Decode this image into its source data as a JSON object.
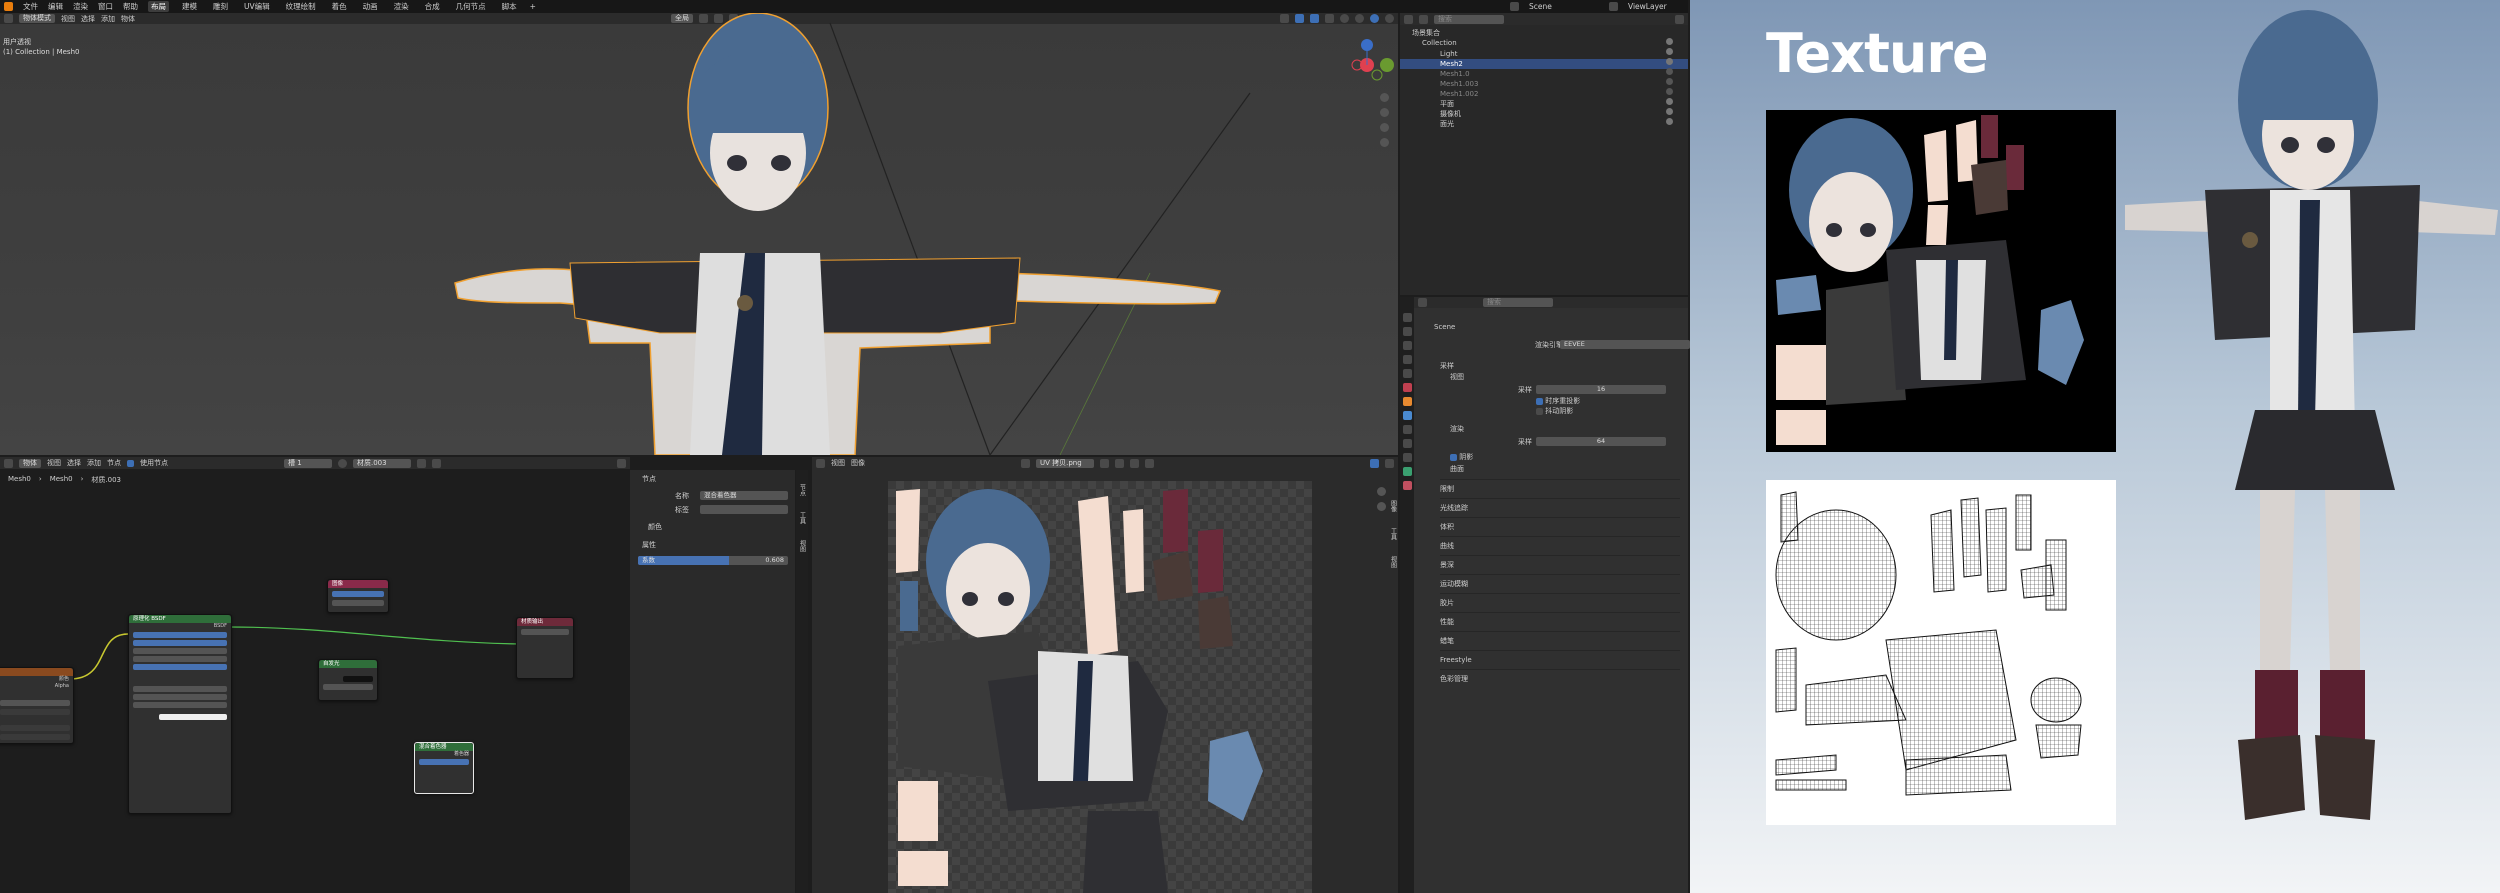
{
  "menubar": {
    "menus": [
      "文件",
      "编辑",
      "渲染",
      "窗口",
      "帮助"
    ],
    "workspaces": [
      "布局",
      "建模",
      "雕刻",
      "UV编辑",
      "纹理绘制",
      "着色",
      "动画",
      "渲染",
      "合成",
      "几何节点",
      "脚本"
    ],
    "active_workspace": "布局",
    "scene": "Scene",
    "viewlayer": "ViewLayer"
  },
  "viewport": {
    "mode": "物体模式",
    "menus": [
      "视图",
      "选择",
      "添加",
      "物体"
    ],
    "transform": "全局",
    "overlay_title": "用户透视",
    "overlay_sub": "(1) Collection | Mesh0"
  },
  "outliner": {
    "search_placeholder": "搜索",
    "root": "场景集合",
    "collection": "Collection",
    "items": [
      "Light",
      "Mesh2",
      "Mesh1.0",
      "Mesh1.003",
      "Mesh1.002",
      "平面",
      "摄像机",
      "面光"
    ],
    "selected_index": 1
  },
  "properties": {
    "search_placeholder": "搜索",
    "scene": "Scene",
    "engine_label": "渲染引擎",
    "engine": "EEVEE",
    "sections": [
      {
        "label": "采样"
      },
      {
        "label": "视图"
      },
      {
        "label": "采样",
        "value": "16"
      },
      {
        "label": "时序重投影"
      },
      {
        "label": "抖动阴影"
      },
      {
        "label": "渲染"
      },
      {
        "label": "采样",
        "value": "64"
      },
      {
        "label": "阴影"
      },
      {
        "label": "曲面"
      }
    ],
    "closed_sections": [
      "限制",
      "光线追踪",
      "体积",
      "曲线",
      "景深",
      "运动模糊",
      "胶片",
      "性能",
      "蜡笔",
      "Freestyle",
      "色彩管理"
    ]
  },
  "node_editor": {
    "object": "物体",
    "menus": [
      "视图",
      "选择",
      "添加",
      "节点"
    ],
    "use_nodes": "使用节点",
    "slot": "槽 1",
    "material": "材质.003",
    "breadcrumb": [
      "Mesh0",
      "Mesh0",
      "材质.003"
    ],
    "nodes": {
      "principled": "原理化 BSDF",
      "output": "材质输出",
      "image": "图像",
      "mix": "混合着色器",
      "emission": "自发光",
      "attribute": "属性"
    },
    "side_tabs": [
      "节点",
      "工具",
      "视图"
    ]
  },
  "node_props": {
    "section": "节点",
    "name_label": "名称",
    "name_value": "混合着色器",
    "label_label": "标签",
    "color_label": "颜色",
    "attr_label": "属性",
    "factor_label": "系数",
    "factor_value": "0.608",
    "factor": 0.608
  },
  "uv_editor": {
    "menus": [
      "视图",
      "图像"
    ],
    "image": "UV 拷贝.png",
    "side_tabs": [
      "图像",
      "工具",
      "视图"
    ]
  },
  "texture_panel": {
    "title": "Texture"
  },
  "colors": {
    "accent": "#4772b3",
    "selection_orange": "#f0a030",
    "bg_dark": "#1d1d1d",
    "panel": "#303030"
  }
}
